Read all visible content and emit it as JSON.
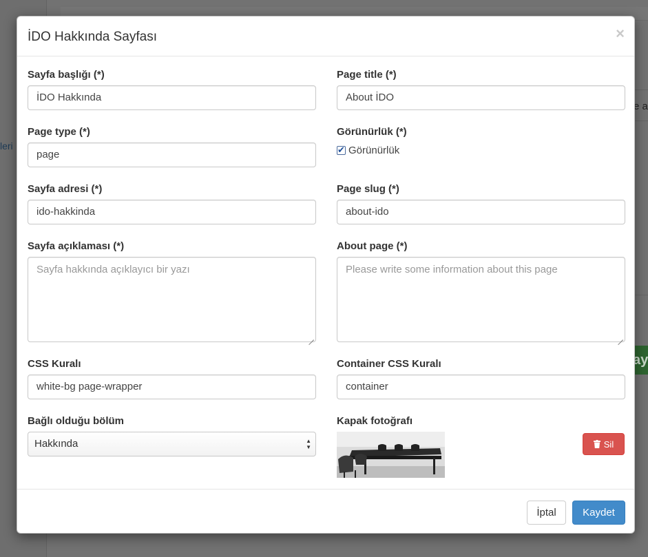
{
  "background": {
    "sidebar_text": "leri",
    "panel_text": "e a",
    "green_button_text": "ay"
  },
  "modal": {
    "title": "İDO Hakkında Sayfası",
    "close_label": "×",
    "fields": {
      "sayfa_basligi": {
        "label": "Sayfa başlığı (*)",
        "value": "İDO Hakkında"
      },
      "page_title": {
        "label": "Page title (*)",
        "value": "About İDO"
      },
      "page_type": {
        "label": "Page type (*)",
        "value": "page"
      },
      "gorunurluk": {
        "label": "Görünürlük (*)",
        "checkbox_label": "Görünürlük",
        "checked": true
      },
      "sayfa_adresi": {
        "label": "Sayfa adresi (*)",
        "value": "ido-hakkinda"
      },
      "page_slug": {
        "label": "Page slug (*)",
        "value": "about-ido"
      },
      "sayfa_aciklamasi": {
        "label": "Sayfa açıklaması (*)",
        "placeholder": "Sayfa hakkında açıklayıcı bir yazı"
      },
      "about_page": {
        "label": "About page (*)",
        "placeholder": "Please write some information about this page"
      },
      "css_kurali": {
        "label": "CSS Kuralı",
        "value": "white-bg page-wrapper"
      },
      "container_css": {
        "label": "Container CSS Kuralı",
        "value": "container"
      },
      "bagli_bolum": {
        "label": "Bağlı olduğu bölüm",
        "selected": "Hakkında"
      },
      "kapak_fotografi": {
        "label": "Kapak fotoğrafı",
        "delete_label": "Sil"
      }
    },
    "footer": {
      "cancel_label": "İptal",
      "save_label": "Kaydet"
    }
  },
  "colors": {
    "primary": "#428bca",
    "danger": "#d9534f",
    "overlay": "#727272"
  },
  "icons": {
    "close": "close-icon",
    "trash": "trash-icon",
    "select_arrows": "select-arrows-icon",
    "check": "checkmark-icon"
  }
}
